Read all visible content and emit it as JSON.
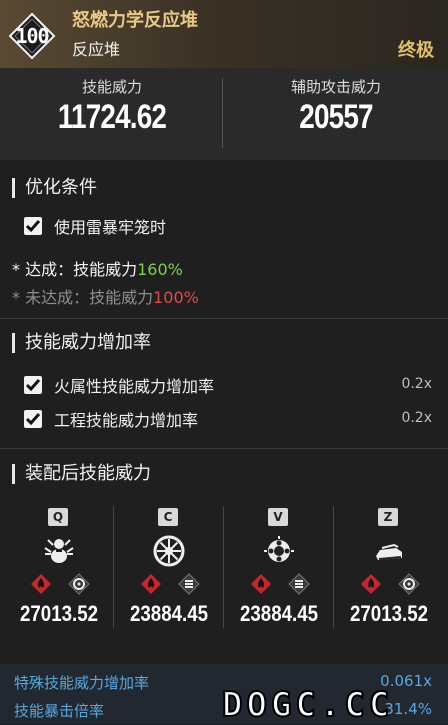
{
  "header": {
    "level": "100",
    "title": "怒燃力学反应堆",
    "subtitle": "反应堆",
    "grade": "终极",
    "grade_color": "#e3c16a"
  },
  "stats": [
    {
      "label": "技能威力",
      "value": "11724.62"
    },
    {
      "label": "辅助攻击威力",
      "value": "20557"
    }
  ],
  "optimize": {
    "title": "优化条件",
    "checkbox_label": "使用雷暴牢笼时",
    "achieved": {
      "prefix": "* 达成：技能威力",
      "pct": "160%"
    },
    "not_achieved": {
      "prefix": "* 未达成：技能威力",
      "pct": "100%"
    }
  },
  "increase": {
    "title": "技能威力增加率",
    "items": [
      {
        "label": "火属性技能威力增加率",
        "value": "0.2x"
      },
      {
        "label": "工程技能威力增加率",
        "value": "0.2x"
      }
    ]
  },
  "equipped": {
    "title": "装配后技能威力",
    "skills": [
      {
        "key": "Q",
        "value": "27013.52",
        "icon": "summon-robot-icon"
      },
      {
        "key": "C",
        "value": "23884.45",
        "icon": "wheel-icon"
      },
      {
        "key": "V",
        "value": "23884.45",
        "icon": "gear-burst-icon"
      },
      {
        "key": "Z",
        "value": "27013.52",
        "icon": "tank-icon"
      }
    ],
    "element_icons": [
      "fire-element-icon",
      "tech-element-icon"
    ]
  },
  "footer": {
    "rows": [
      {
        "label": "特殊技能威力增加率",
        "value": "0.061x"
      },
      {
        "label": "技能暴击倍率",
        "value": "31.4%"
      }
    ],
    "accent": "#58a8e0"
  },
  "watermark": "DOGC.CC"
}
